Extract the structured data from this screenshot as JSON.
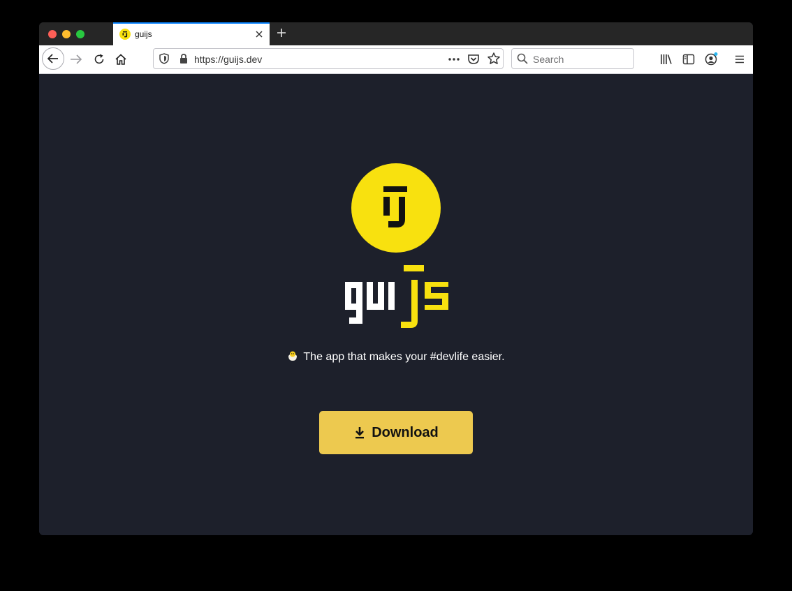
{
  "browser": {
    "tab": {
      "title": "guijs"
    },
    "url": "https://guijs.dev",
    "search": {
      "placeholder": "Search"
    }
  },
  "page": {
    "logo_text": "guijs",
    "tagline": "The app that makes your #devlife easier.",
    "download_label": "Download"
  },
  "colors": {
    "brand_yellow": "#f8e10f",
    "button_yellow": "#edc94f",
    "background": "#1d202b",
    "tab_accent": "#0a84ff"
  },
  "icons": [
    "close-icon",
    "plus-icon",
    "back-arrow-icon",
    "forward-arrow-icon",
    "reload-icon",
    "home-icon",
    "shield-icon",
    "lock-icon",
    "more-icon",
    "pocket-icon",
    "star-icon",
    "search-icon",
    "library-icon",
    "sidebar-icon",
    "account-icon",
    "menu-icon",
    "chick-emoji-icon",
    "download-icon"
  ]
}
